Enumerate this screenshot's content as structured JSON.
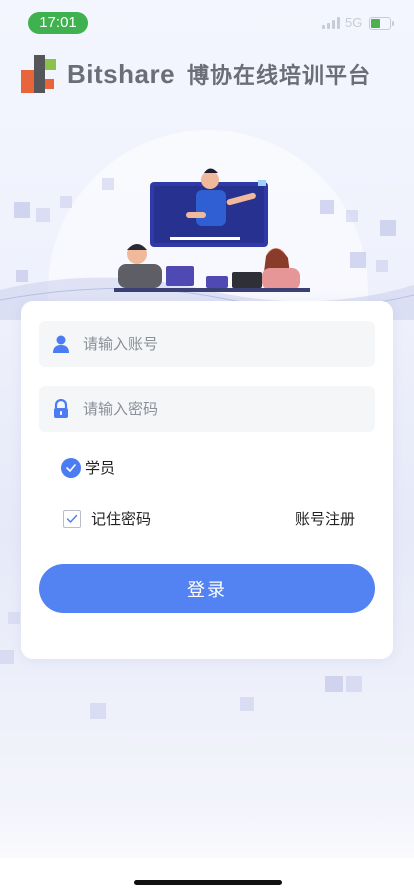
{
  "status_bar": {
    "time": "17:01",
    "network": "5G"
  },
  "header": {
    "app_name": "Bitshare",
    "subtitle": "博协在线培训平台",
    "logo_colors": [
      "#e8643a",
      "#55565a",
      "#8bc34a"
    ]
  },
  "login_form": {
    "account_placeholder": "请输入账号",
    "password_placeholder": "请输入密码",
    "role_label": "学员",
    "remember_label": "记住密码",
    "register_label": "账号注册",
    "login_button_label": "登录"
  },
  "colors": {
    "accent": "#5383f2",
    "status_green": "#3fb24f"
  },
  "icons": [
    "user-icon",
    "lock-icon",
    "check-icon",
    "signal-icon",
    "battery-icon"
  ]
}
